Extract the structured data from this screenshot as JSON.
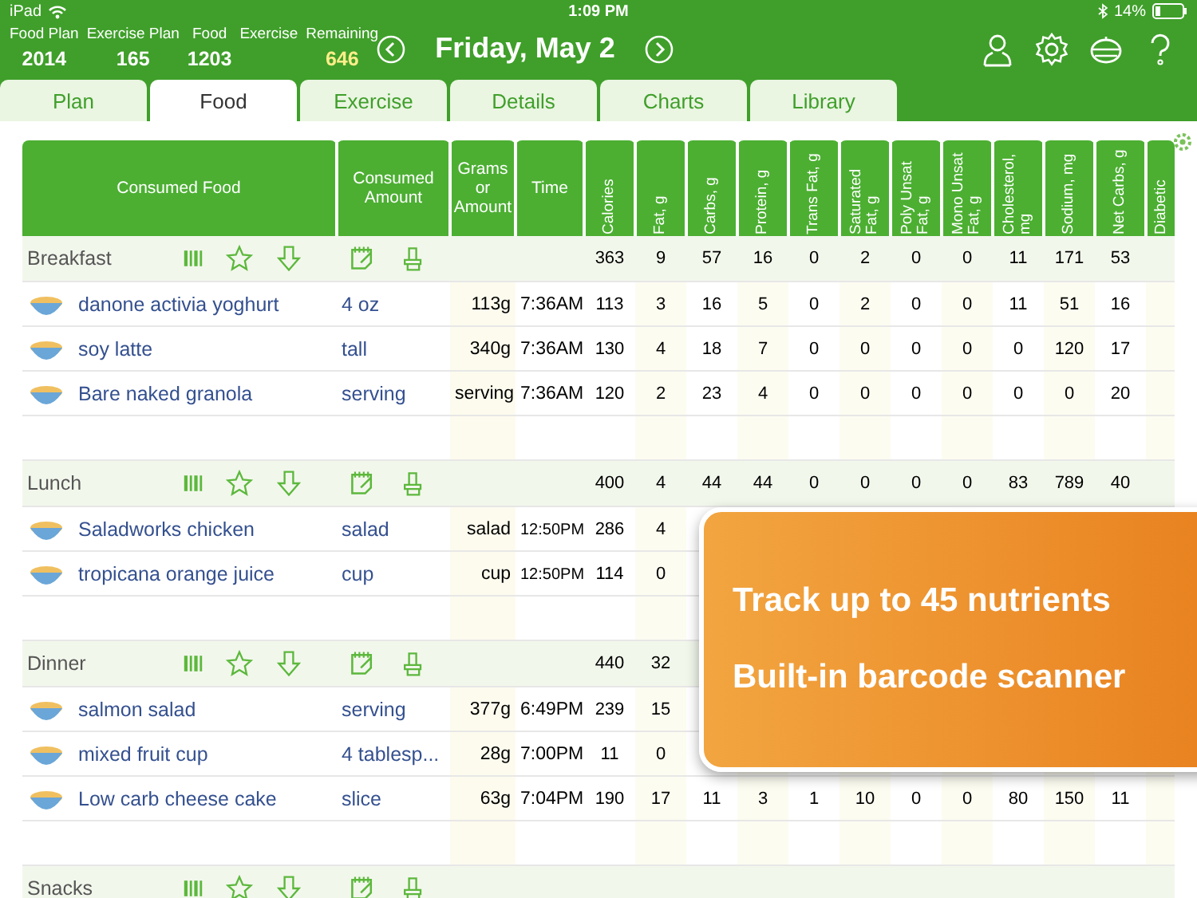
{
  "status_bar": {
    "device": "iPad",
    "time": "1:09 PM",
    "battery": "14%"
  },
  "summary": [
    {
      "label": "Food Plan",
      "value": "2014",
      "highlighted": false
    },
    {
      "label": "Exercise Plan",
      "value": "165",
      "highlighted": false
    },
    {
      "label": "Food",
      "value": "1203",
      "highlighted": false
    },
    {
      "label": "Exercise"
    },
    {
      "label": "Remaining",
      "value": "646",
      "highlighted": true
    }
  ],
  "date": "Friday, May 2",
  "tabs": [
    {
      "label": "Plan",
      "selected": false
    },
    {
      "label": "Food",
      "selected": true
    },
    {
      "label": "Exercise",
      "selected": false
    },
    {
      "label": "Details",
      "selected": false
    },
    {
      "label": "Charts",
      "selected": false
    },
    {
      "label": "Library",
      "selected": false
    }
  ],
  "table": {
    "columns": [
      {
        "label": "Consumed Food",
        "kind": "text"
      },
      {
        "label": "Consumed Amount",
        "kind": "text"
      },
      {
        "label": "Grams or Amount",
        "kind": "text"
      },
      {
        "label": "Time",
        "kind": "text"
      },
      {
        "label": "Calories",
        "kind": "nutrient"
      },
      {
        "label": "Fat, g",
        "kind": "nutrient"
      },
      {
        "label": "Carbs, g",
        "kind": "nutrient"
      },
      {
        "label": "Protein, g",
        "kind": "nutrient"
      },
      {
        "label": "Trans Fat, g",
        "kind": "nutrient"
      },
      {
        "label": "Saturated Fat, g",
        "kind": "nutrient"
      },
      {
        "label": "Poly Unsat Fat, g",
        "kind": "nutrient"
      },
      {
        "label": "Mono Unsat Fat, g",
        "kind": "nutrient"
      },
      {
        "label": "Cholesterol, mg",
        "kind": "nutrient"
      },
      {
        "label": "Sodium, mg",
        "kind": "nutrient"
      },
      {
        "label": "Net Carbs, g",
        "kind": "nutrient"
      },
      {
        "label": "Diabetic",
        "kind": "nutrient"
      }
    ],
    "groups": [
      {
        "name": "Breakfast",
        "totals": [
          "363",
          "9",
          "57",
          "16",
          "0",
          "2",
          "0",
          "0",
          "11",
          "171",
          "53"
        ],
        "items": [
          {
            "name": "danone activia yoghurt",
            "amount": "4 oz",
            "grams": "113g",
            "time": "7:36AM",
            "values": [
              "113",
              "3",
              "16",
              "5",
              "0",
              "2",
              "0",
              "0",
              "11",
              "51",
              "16"
            ]
          },
          {
            "name": "soy latte",
            "amount": "tall",
            "grams": "340g",
            "time": "7:36AM",
            "values": [
              "130",
              "4",
              "18",
              "7",
              "0",
              "0",
              "0",
              "0",
              "0",
              "120",
              "17"
            ]
          },
          {
            "name": "Bare naked granola",
            "amount": "serving",
            "grams": "serving",
            "time": "7:36AM",
            "values": [
              "120",
              "2",
              "23",
              "4",
              "0",
              "0",
              "0",
              "0",
              "0",
              "0",
              "20"
            ]
          }
        ]
      },
      {
        "name": "Lunch",
        "totals": [
          "400",
          "4",
          "44",
          "44",
          "0",
          "0",
          "0",
          "0",
          "83",
          "789",
          "40"
        ],
        "items": [
          {
            "name": "Saladworks chicken",
            "amount": "salad",
            "grams": "salad",
            "time": "12:50PM",
            "values": [
              "286",
              "4"
            ]
          },
          {
            "name": "tropicana orange juice",
            "amount": "cup",
            "grams": "cup",
            "time": "12:50PM",
            "values": [
              "114",
              "0"
            ]
          }
        ]
      },
      {
        "name": "Dinner",
        "totals": [
          "440",
          "32"
        ],
        "items": [
          {
            "name": "salmon salad",
            "amount": "serving",
            "grams": "377g",
            "time": "6:49PM",
            "values": [
              "239",
              "15"
            ]
          },
          {
            "name": "mixed fruit cup",
            "amount": "4 tablesp...",
            "grams": "28g",
            "time": "7:00PM",
            "values": [
              "11",
              "0"
            ]
          },
          {
            "name": "Low carb cheese cake",
            "amount": "slice",
            "grams": "63g",
            "time": "7:04PM",
            "values": [
              "190",
              "17",
              "11",
              "3",
              "1",
              "10",
              "0",
              "0",
              "80",
              "150",
              "11"
            ]
          }
        ]
      },
      {
        "name": "Snacks"
      }
    ]
  },
  "callout": {
    "lines": [
      "Track up to 45 nutrients",
      "Built-in barcode scanner"
    ]
  }
}
